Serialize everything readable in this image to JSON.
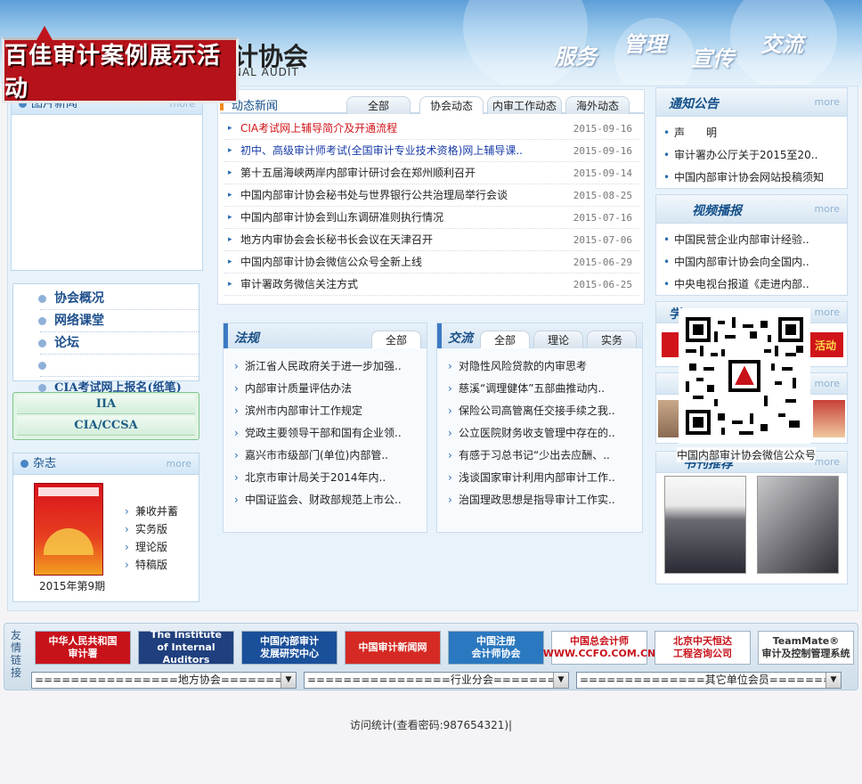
{
  "header": {
    "logo_text": "计协会",
    "logo_sub": "NAL AUDIT",
    "slogans": [
      "服务",
      "管理",
      "宣传",
      "交流"
    ],
    "banner": "百佳审计案例展示活动"
  },
  "left": {
    "photo_news_title": "图片新闻",
    "more": "more",
    "nav": [
      "协会概况",
      "网络课堂",
      "论坛",
      "",
      "CIA考试网上报名(纸笔)"
    ],
    "iia": [
      "IIA",
      "CIA/CCSA"
    ],
    "magazine_title": "杂志",
    "magazine_issue": "2015年第9期",
    "magazine_links": [
      "兼收并蓄",
      "实务版",
      "理论版",
      "特稿版"
    ]
  },
  "news": {
    "title": "动态新闻",
    "tabs": [
      "全部",
      "协会动态",
      "内审工作动态",
      "海外动态"
    ],
    "items": [
      {
        "text": "CIA考试网上辅导简介及开通流程",
        "date": "2015-09-16",
        "color": "red"
      },
      {
        "text": "初中、高级审计师考试(全国审计专业技术资格)网上辅导课..",
        "date": "2015-09-16",
        "color": "blue"
      },
      {
        "text": "第十五届海峡两岸内部审计研讨会在郑州顺利召开",
        "date": "2015-09-14",
        "color": ""
      },
      {
        "text": "中国内部审计协会秘书处与世界银行公共治理局举行会谈",
        "date": "2015-08-25",
        "color": ""
      },
      {
        "text": "中国内部审计协会到山东调研准则执行情况",
        "date": "2015-07-16",
        "color": ""
      },
      {
        "text": "地方内审协会会长秘书长会议在天津召开",
        "date": "2015-07-06",
        "color": ""
      },
      {
        "text": "中国内部审计协会微信公众号全新上线",
        "date": "2015-06-29",
        "color": ""
      },
      {
        "text": "审计署政务微信关注方式",
        "date": "2015-06-25",
        "color": ""
      }
    ]
  },
  "law": {
    "title": "法规",
    "tabs": [
      "全部"
    ],
    "items": [
      "浙江省人民政府关于进一步加强..",
      "内部审计质量评估办法",
      "滨州市内部审计工作规定",
      "党政主要领导干部和国有企业领..",
      "嘉兴市市级部门(单位)内部管..",
      "北京市审计局关于2014年内..",
      "中国证监会、财政部规范上市公.."
    ]
  },
  "exchange": {
    "title": "交流",
    "tabs": [
      "全部",
      "理论",
      "实务"
    ],
    "items": [
      "对隐性风险贷款的内审思考",
      "慈溪“调理健体”五部曲推动内..",
      "保险公司高管离任交接手续之我..",
      "公立医院财务收支管理中存在的..",
      "有感于习总书记“少出去应酬、..",
      "浅谈国家审计利用内部审计工作..",
      "治国理政思想是指导审计工作实.."
    ]
  },
  "right": {
    "notice_title": "通知公告",
    "notice_items": [
      "声　　明",
      "审计署办公厅关于2015至20..",
      "中国内部审计协会网站投稿须知"
    ],
    "video_title": "视频播报",
    "video_items": [
      "中国民营企业内部审计经验..",
      "中国内部审计协会向全国内..",
      "中央电视台报道《走进内部.."
    ],
    "promo_title": "学习",
    "promo_text": "活动",
    "book_title": "书刊推荐",
    "more": "more",
    "qr_caption": "中国内部审计协会微信公众号"
  },
  "links": {
    "side_label": "友情链接",
    "logos": [
      {
        "text": "中华人民共和国\n审计署",
        "bg": "#c8121a",
        "fg": "#ffffff"
      },
      {
        "text": "The Institute\nof Internal Auditors",
        "bg": "#1f3f7e",
        "fg": "#ffffff"
      },
      {
        "text": "中国内部审计\n发展研究中心",
        "bg": "#1a4f9a",
        "fg": "#ffffff"
      },
      {
        "text": "中国审计新闻网",
        "bg": "#d52a24",
        "fg": "#ffffff"
      },
      {
        "text": "中国注册\n会计师协会",
        "bg": "#2a78bf",
        "fg": "#ffffff"
      },
      {
        "text": "中国总会计师\nWWW.CCFO.COM.CN",
        "bg": "#ffffff",
        "fg": "#c8121a"
      },
      {
        "text": "北京中天恒达\n工程咨询公司",
        "bg": "#ffffff",
        "fg": "#c8121a"
      },
      {
        "text": "TeamMate®\n审计及控制管理系统",
        "bg": "#ffffff",
        "fg": "#333333"
      }
    ],
    "selects": [
      "================地方协会================",
      "================行业分会================",
      "==============其它单位会员=============="
    ]
  },
  "footer": "访问统计(查看密码:987654321)|"
}
